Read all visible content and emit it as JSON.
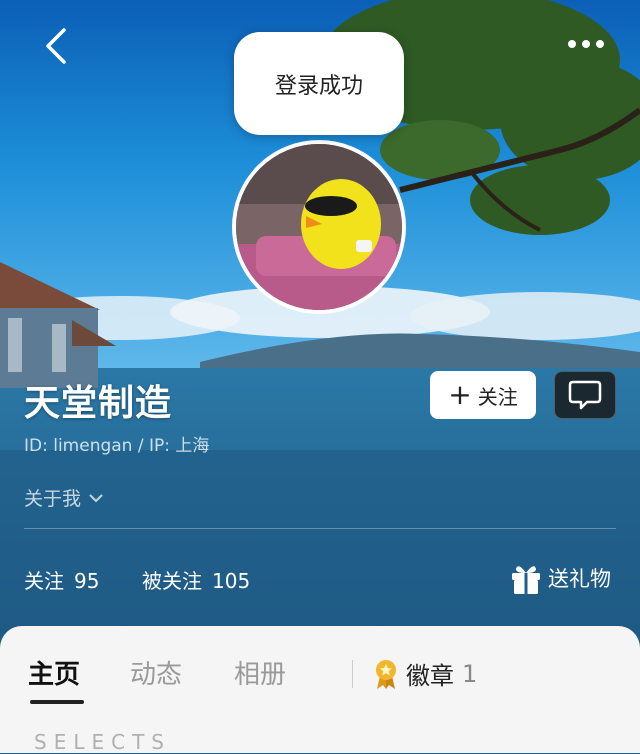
{
  "toast": {
    "text": "登录成功"
  },
  "profile": {
    "name": "天堂制造",
    "id_ip": "ID: limengan / IP: 上海",
    "about_label": "关于我"
  },
  "actions": {
    "follow_label": "关注"
  },
  "stats": {
    "following_label": "关注",
    "following_count": "95",
    "followers_label": "被关注",
    "followers_count": "105",
    "gift_label": "送礼物"
  },
  "tabs": [
    {
      "label": "主页",
      "active": true
    },
    {
      "label": "动态",
      "active": false
    },
    {
      "label": "相册",
      "active": false
    }
  ],
  "badge": {
    "label": "徽章",
    "count": "1"
  },
  "section": {
    "title": "SELECTS"
  },
  "icons": [
    "back-icon",
    "more-icon",
    "plus-icon",
    "message-icon",
    "chevron-down-icon",
    "gift-icon",
    "medal-icon"
  ]
}
